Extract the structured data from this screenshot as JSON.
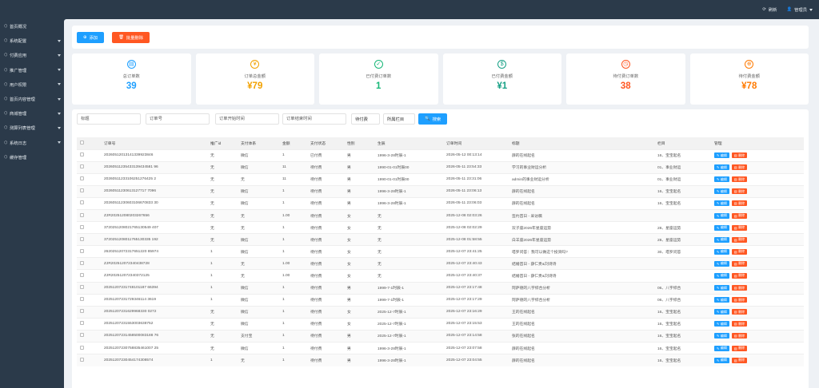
{
  "topbar": {
    "refresh": "刷新",
    "user": "管理员"
  },
  "sidebar": {
    "items": [
      {
        "label": "首页概况",
        "icon": "home-icon",
        "has_arrow": false
      },
      {
        "label": "系统配置",
        "icon": "gear-icon",
        "has_arrow": true
      },
      {
        "label": "付费应用",
        "icon": "list-icon",
        "has_arrow": true
      },
      {
        "label": "推广管理",
        "icon": "share-icon",
        "has_arrow": true
      },
      {
        "label": "用户权限",
        "icon": "user-icon",
        "has_arrow": true
      },
      {
        "label": "首页内容管理",
        "icon": "grid-icon",
        "has_arrow": true
      },
      {
        "label": "商城管理",
        "icon": "cart-icon",
        "has_arrow": true
      },
      {
        "label": "测算列表管理",
        "icon": "chart-icon",
        "has_arrow": true
      },
      {
        "label": "系统日志",
        "icon": "log-icon",
        "has_arrow": true
      },
      {
        "label": "缓存管理",
        "icon": "cache-icon",
        "has_arrow": false
      }
    ]
  },
  "toolbar": {
    "add_label": "添加",
    "batch_delete_label": "批量删除"
  },
  "stats": [
    {
      "label": "总订单数",
      "value": "39",
      "color": "#1e9fff",
      "icon": "document-icon",
      "glyph": "▤"
    },
    {
      "label": "订单总金额",
      "value": "¥79",
      "color": "#f2a100",
      "icon": "coin-icon",
      "glyph": "¥"
    },
    {
      "label": "已付费订单数",
      "value": "1",
      "color": "#16b777",
      "icon": "check-circle-icon",
      "glyph": "✓"
    },
    {
      "label": "已付费金额",
      "value": "¥1",
      "color": "#16a085",
      "icon": "dollar-icon",
      "glyph": "$"
    },
    {
      "label": "待付费订单数",
      "value": "38",
      "color": "#ff5722",
      "icon": "clock-icon",
      "glyph": "◷"
    },
    {
      "label": "待付费金额",
      "value": "¥78",
      "color": "#ff7a00",
      "icon": "globe-icon",
      "glyph": "⊕"
    }
  ],
  "filters": {
    "title_placeholder": "标题",
    "order_no_placeholder": "订单号",
    "start_placeholder": "订单开始时间",
    "end_placeholder": "订单结束时间",
    "status_value": "待付费",
    "column_value": "所属栏目",
    "search_label": "搜索"
  },
  "table": {
    "headers": [
      "订单号",
      "推广id",
      "支付体系",
      "金额",
      "支付状态",
      "性别",
      "生辰",
      "订单时间",
      "标题",
      "栏目",
      "管理"
    ],
    "edit_label": "编辑",
    "delete_label": "删除",
    "rows": [
      [
        "20260512013141339923846",
        "无",
        "微信",
        "1",
        "已付费",
        "男",
        "1996-3-28时辰-1",
        "2026-05-12 00:13:14",
        "薛的在线起名",
        "16、宝宝起名"
      ],
      [
        "20260511235433139434581 96",
        "无",
        "微信",
        "11",
        "待付费",
        "男",
        "1990-01-01时辰00",
        "2026-05-11 23:54:33",
        "学习的事业财运分析",
        "01、事业财运"
      ],
      [
        "20260511233106251276425 2",
        "无",
        "无",
        "11",
        "待付费",
        "男",
        "1990-01-01时辰00",
        "2026-05-11 23:31:06",
        "admin的事业财运分析",
        "01、事业财运"
      ],
      [
        "20260511230613127717 7096",
        "无",
        "微信",
        "1",
        "待付费",
        "男",
        "1996-3-28时辰-1",
        "2026-05-11 23:06:13",
        "薛的在线起名",
        "16、宝宝起名"
      ],
      [
        "20260511230603106670833 30",
        "无",
        "微信",
        "1",
        "待付费",
        "男",
        "1996-3-28时辰-1",
        "2026-05-11 23:06:03",
        "薛的在线起名",
        "16、宝宝起名"
      ],
      [
        "ZJR202512080203267656",
        "无",
        "无",
        "1.00",
        "待付费",
        "女",
        "无",
        "2025-12-08 02:03:26",
        "签约首日 - 采访稿",
        ""
      ],
      [
        "3720251208021765130549 407",
        "无",
        "无",
        "1",
        "待付费",
        "女",
        "无",
        "2025-12-08 02:02:29",
        "双子座2026年星座运势",
        "28、星座运势"
      ],
      [
        "3720251208011765130335 192",
        "无",
        "微信",
        "1",
        "待付费",
        "女",
        "无",
        "2025-12-08 01:58:55",
        "白羊座2026年星座运势",
        "28、星座运势"
      ],
      [
        "26202512072317651220 85974",
        "1",
        "微信",
        "1",
        "待付费",
        "女",
        "无",
        "2025-12-07 23:41:25",
        "塔罗问答：我可以做这个投资吗?",
        "30、塔罗问答"
      ],
      [
        "ZJR202512072340438728",
        "1",
        "无",
        "1.00",
        "待付费",
        "女",
        "无",
        "2025-12-07 23:40:43",
        "结婚首日 - 薛仁贵&刘诗诗",
        ""
      ],
      [
        "ZJR202512072340372125",
        "1",
        "无",
        "1.00",
        "待付费",
        "女",
        "无",
        "2025-12-07 23:40:37",
        "结婚首日 - 薛仁贵&刘诗诗",
        ""
      ],
      [
        "20251207231748101187 66394",
        "1",
        "微信",
        "1",
        "待付费",
        "男",
        "1999-7-1时辰-1",
        "2025-12-07 23:17:48",
        "阿萨德的八字综合分析",
        "06、八字综合"
      ],
      [
        "20251207231729346114 3619",
        "1",
        "微信",
        "1",
        "待付费",
        "男",
        "1999-7-1时辰-1",
        "2025-12-07 23:17:29",
        "阿萨德的八字综合分析",
        "06、八字综合"
      ],
      [
        "20251207231629968330 0272",
        "无",
        "微信",
        "1",
        "待付费",
        "女",
        "2025-12-7时辰-1",
        "2025-12-07 23:16:29",
        "王的在线起名",
        "16、宝宝起名"
      ],
      [
        "20251207231553003638752",
        "无",
        "微信",
        "1",
        "待付费",
        "女",
        "2025-12-7时辰-1",
        "2025-12-07 23:15:53",
        "王的在线起名",
        "16、宝宝起名"
      ],
      [
        "20251207231458500083188 76",
        "无",
        "支付宝",
        "1",
        "待付费",
        "男",
        "2025-12-7时辰-1",
        "2025-12-07 23:14:58",
        "张的在线起名",
        "16、宝宝起名"
      ],
      [
        "20251207230758835461007 25",
        "无",
        "微信",
        "1",
        "待付费",
        "男",
        "1996-3-28时辰-1",
        "2025-12-07 23:07:58",
        "薛的在线起名",
        "16、宝宝起名"
      ],
      [
        "20251207230454174308574",
        "1",
        "无",
        "1",
        "待付费",
        "男",
        "1996-3-28时辰-1",
        "2025-12-07 23:04:55",
        "薛的在线起名",
        "16、宝宝起名"
      ]
    ]
  }
}
